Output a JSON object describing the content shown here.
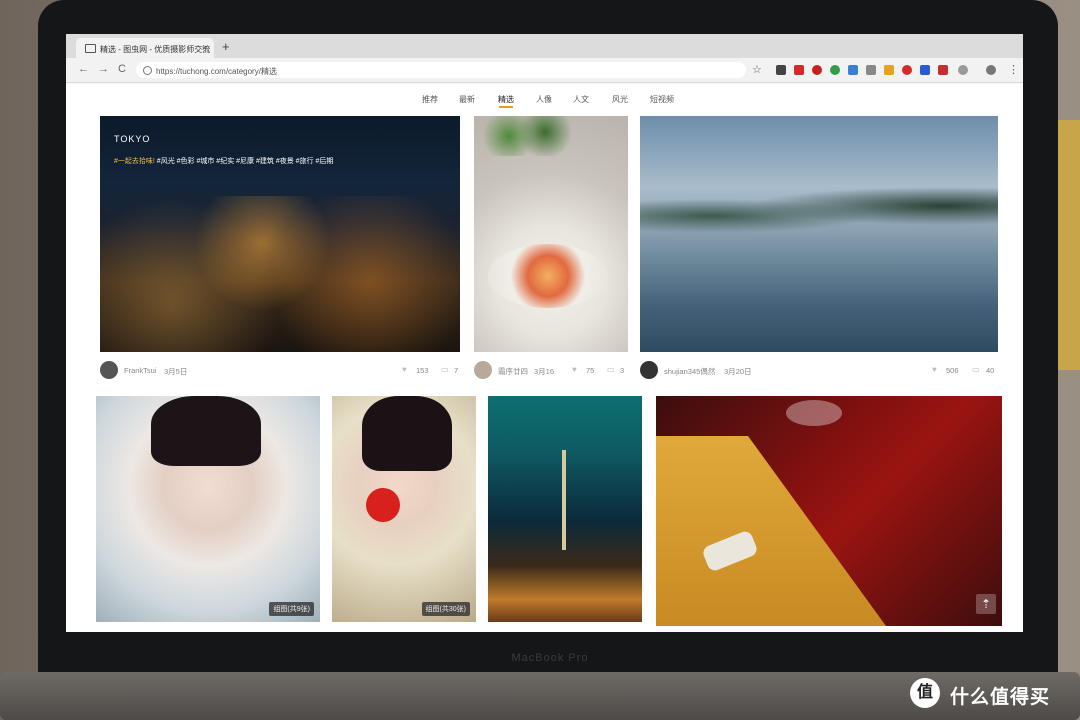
{
  "browser": {
    "tab_title": "精选 - 图虫网 - 优质摄影师交流",
    "tab_close": "×",
    "new_tab": "+",
    "back": "←",
    "forward": "→",
    "reload": "C",
    "url": "https://tuchong.com/category/精选",
    "star": "☆",
    "menu": "⋮"
  },
  "site_nav": {
    "items": [
      "推荐",
      "最新",
      "精选",
      "人像",
      "人文",
      "风光",
      "短视频"
    ],
    "active_index": 2
  },
  "photos": {
    "tokyo": {
      "title": "TOKYO",
      "tag_highlight": "#一起去拾味!",
      "tags": "#风光 #色彩 #城市 #纪实 #尼康 #建筑 #夜景 #旅行 #后期"
    },
    "group1_badge": "组图(共9张)",
    "group2_badge": "组图(共30张)",
    "back_to_top": "⇡"
  },
  "posts": [
    {
      "author": "FrankTsui",
      "date": "3月5日",
      "likes": "153",
      "comments": "7"
    },
    {
      "author": "霜序廿四",
      "date": "3月16",
      "likes": "75",
      "comments": "3"
    },
    {
      "author": "shujian345偶然",
      "date": "3月20日",
      "likes": "506",
      "comments": "40"
    }
  ],
  "hardware": {
    "brand": "MacBook Pro"
  },
  "watermark": {
    "logo": "值",
    "text": "什么值得买"
  },
  "colors": {
    "accent": "#e0a020",
    "red_ext": "#d42a2a"
  }
}
